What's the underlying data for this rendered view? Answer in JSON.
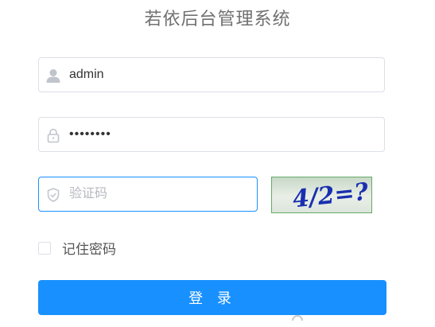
{
  "app": {
    "title": "若依后台管理系统"
  },
  "login_form": {
    "username": {
      "value": "admin",
      "icon": "user-icon"
    },
    "password": {
      "value": "••••••••",
      "icon": "lock-icon"
    },
    "captcha": {
      "placeholder": "验证码",
      "value": "",
      "icon": "shield-check-icon",
      "image_text": "4/2=?"
    },
    "remember_me": {
      "label": "记住密码",
      "checked": false
    },
    "login_button": {
      "label": "登 录"
    }
  },
  "colors": {
    "primary": "#1890ff",
    "border": "#dcdfe6",
    "title": "#707070",
    "captcha_text": "#1a2fb0"
  }
}
